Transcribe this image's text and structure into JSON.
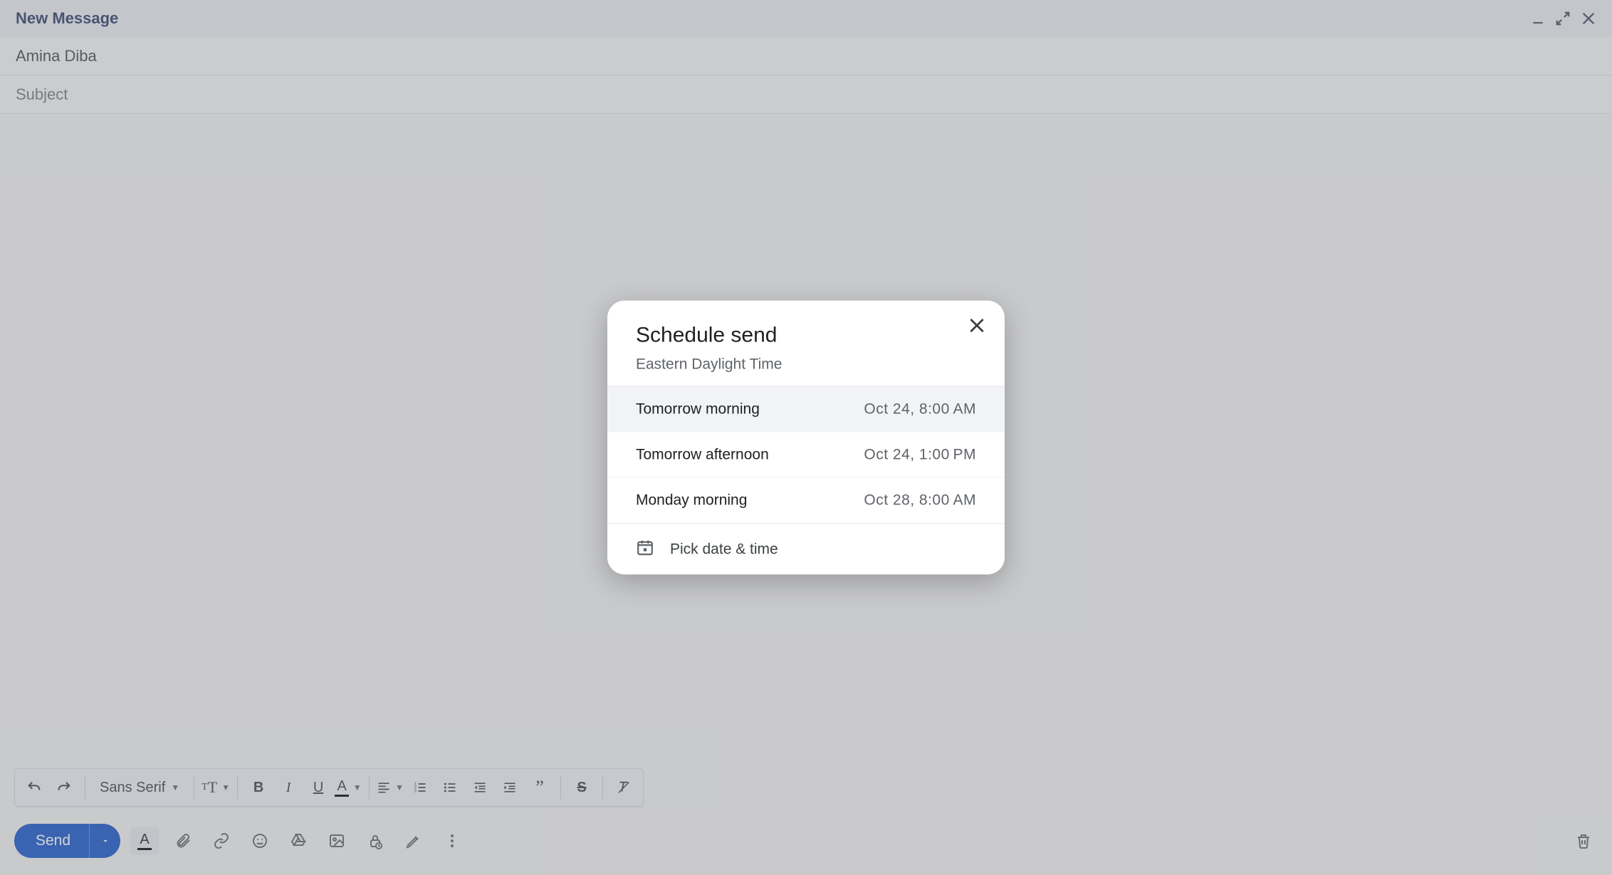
{
  "compose": {
    "title": "New Message",
    "to_value": "Amina Diba",
    "subject_placeholder": "Subject"
  },
  "format_toolbar": {
    "font_label": "Sans Serif"
  },
  "send": {
    "label": "Send"
  },
  "schedule_dialog": {
    "title": "Schedule send",
    "timezone": "Eastern Daylight Time",
    "options": [
      {
        "label": "Tomorrow morning",
        "time": "Oct 24, 8:00 AM"
      },
      {
        "label": "Tomorrow afternoon",
        "time": "Oct 24, 1:00 PM"
      },
      {
        "label": "Monday morning",
        "time": "Oct 28, 8:00 AM"
      }
    ],
    "pick_label": "Pick date & time"
  }
}
